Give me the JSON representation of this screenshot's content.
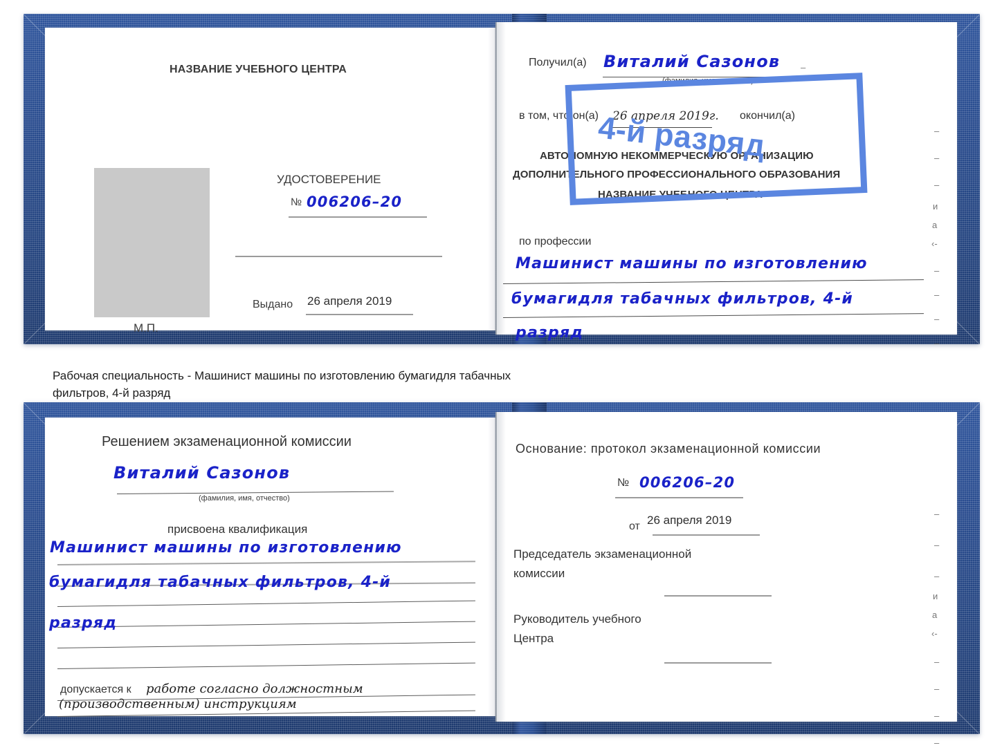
{
  "meta": {
    "document_type": "Удостоверение",
    "stamp_color": "#5b86e0",
    "cover_color": "#2a4d90",
    "ink_color": "#1a22c8"
  },
  "caption": {
    "line1": "Рабочая специальность - Машинист машины по изготовлению бумагидля табачных",
    "line2": "фильтров, 4-й разряд"
  },
  "book_top": {
    "left_page": {
      "header": "НАЗВАНИЕ УЧЕБНОГО ЦЕНТРА",
      "doc_title": "УДОСТОВЕРЕНИЕ",
      "number_label": "№",
      "number_value": "006206–20",
      "issued_label": "Выдано",
      "issued_value": "26 апреля 2019",
      "seal_label": "М.П.",
      "photo_placeholder": "photo-placeholder"
    },
    "right_page": {
      "received_label": "Получил(а)",
      "received_value": "Виталий Сазонов",
      "fio_hint": "(фамилия, имя, отчество)",
      "in_that_label": "в том, что он(а)",
      "completion_date": "26 апреля 2019г.",
      "finished_label": "окончил(а)",
      "org_line1": "АВТОНОМНУЮ НЕКОММЕРЧЕСКУЮ ОРГАНИЗАЦИЮ",
      "org_line2": "ДОПОЛНИТЕЛЬНОГО ПРОФЕССИОНАЛЬНОГО ОБРАЗОВАНИЯ",
      "org_quote_open": "\"",
      "org_name": "НАЗВАНИЕ УЧЕБНОГО ЦЕНТРА",
      "org_quote_close": "\"",
      "profession_label": "по профессии",
      "profession_line1": "Машинист машины по изготовлению",
      "profession_line2": "бумагидля табачных фильтров, 4-й",
      "profession_line3": "разряд",
      "stamp_text": "4-й разряд",
      "edge_marks": [
        "–",
        "–",
        "–",
        "и",
        "а",
        "‹-",
        "–",
        "–",
        "–",
        "–"
      ]
    }
  },
  "book_bottom": {
    "left_page": {
      "header": "Решением экзаменационной комиссии",
      "name_value": "Виталий Сазонов",
      "fio_hint": "(фамилия, имя, отчество)",
      "qualification_label": "присвоена квалификация",
      "qualification_line1": "Машинист машины по изготовлению",
      "qualification_line2": "бумагидля табачных фильтров, 4-й",
      "qualification_line3": "разряд",
      "admitted_label": "допускается к",
      "admitted_value_line1": "работе согласно должностным",
      "admitted_value_line2": "(производственным) инструкциям"
    },
    "right_page": {
      "basis_label": "Основание: протокол экзаменационной комиссии",
      "number_label": "№",
      "number_value": "006206–20",
      "date_label": "от",
      "date_value": "26 апреля 2019",
      "chairman_line1": "Председатель экзаменационной",
      "chairman_line2": "комиссии",
      "head_line1": "Руководитель учебного",
      "head_line2": "Центра",
      "edge_marks": [
        "–",
        "–",
        "–",
        "и",
        "а",
        "‹-",
        "–",
        "–",
        "–",
        "–"
      ]
    }
  }
}
